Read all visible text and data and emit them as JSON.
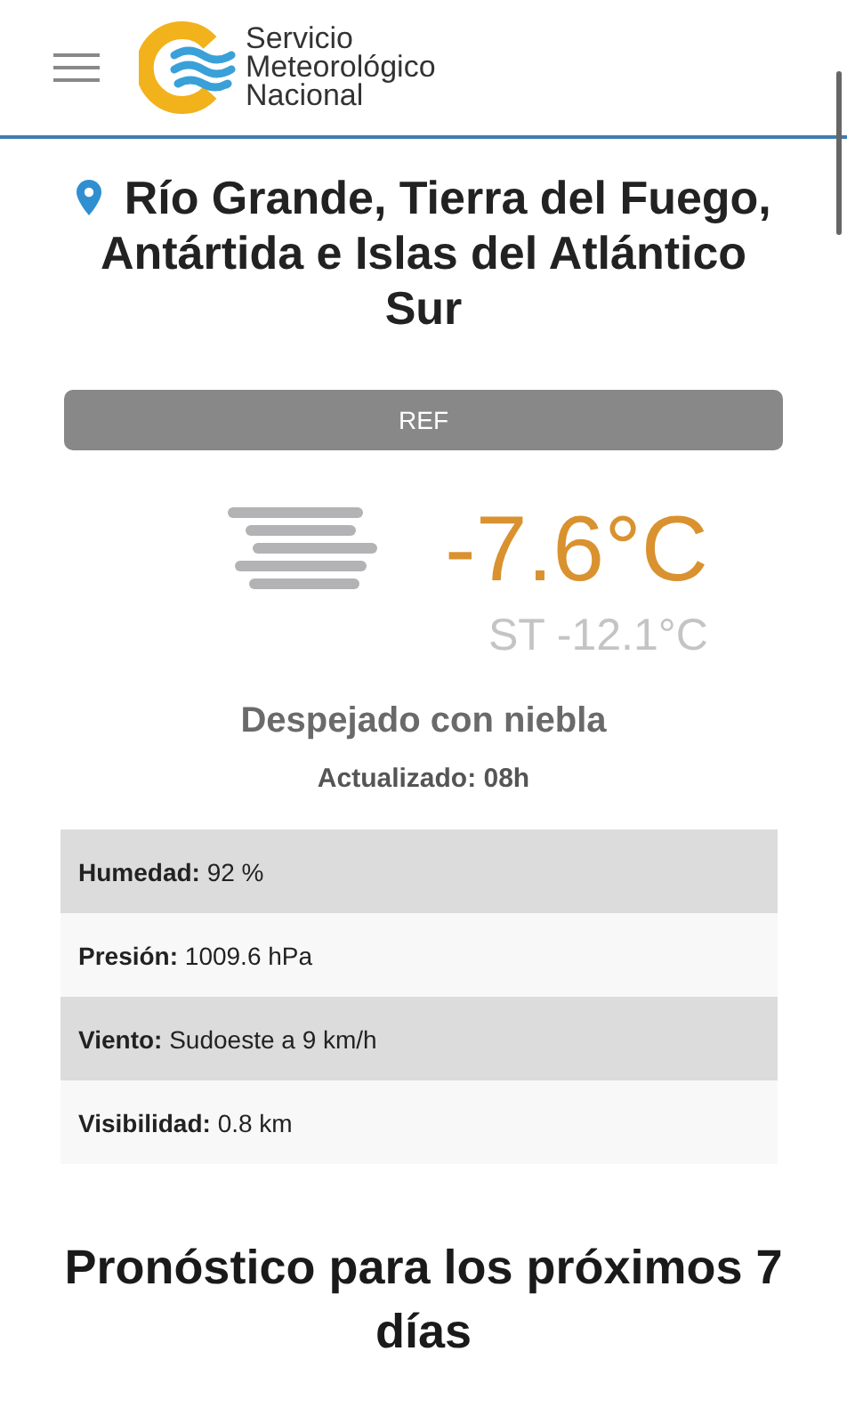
{
  "header": {
    "logo_lines": [
      "Servicio",
      "Meteorológico",
      "Nacional"
    ]
  },
  "location": {
    "name": "Río Grande, Tierra del Fuego, Antártida e Islas del Atlántico Sur"
  },
  "ref_button": {
    "label": "REF"
  },
  "current": {
    "temperature": "-7.6°C",
    "feels_like": "ST -12.1°C",
    "condition": "Despejado con niebla",
    "updated": "Actualizado: 08h"
  },
  "details": [
    {
      "label": "Humedad:",
      "value": "92 %"
    },
    {
      "label": "Presión:",
      "value": "1009.6 hPa"
    },
    {
      "label": "Viento:",
      "value": "Sudoeste a 9 km/h"
    },
    {
      "label": "Visibilidad:",
      "value": "0.8 km"
    }
  ],
  "forecast": {
    "title": "Pronóstico para los próximos 7 días"
  }
}
